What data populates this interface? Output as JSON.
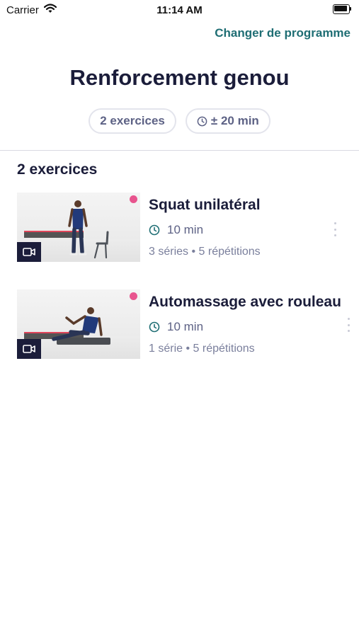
{
  "status_bar": {
    "carrier": "Carrier",
    "time": "11:14 AM"
  },
  "header": {
    "change_program_link": "Changer de programme"
  },
  "program": {
    "title": "Renforcement genou",
    "chips": {
      "exercise_count": "2 exercices",
      "duration": "± 20 min"
    }
  },
  "exercises_section": {
    "title": "2 exercices",
    "items": [
      {
        "name": "Squat unilatéral",
        "duration": "10 min",
        "sets": "3 séries • 5 répétitions",
        "thumbnail_icon": "video-camera-icon"
      },
      {
        "name": "Automassage avec rouleau",
        "duration": "10 min",
        "sets": "1 série • 5 répétitions",
        "thumbnail_icon": "video-camera-icon"
      }
    ]
  },
  "colors": {
    "accent": "#1f6e74",
    "navy": "#1b1d3a",
    "muted": "#5d6285",
    "brand_pink": "#e8548e"
  }
}
